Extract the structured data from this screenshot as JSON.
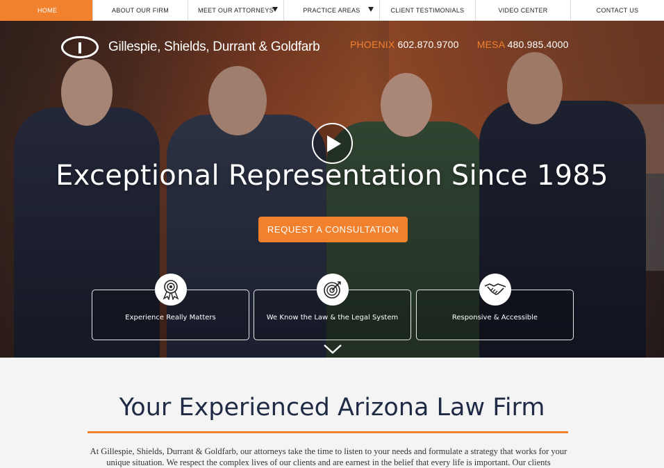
{
  "nav": {
    "items": [
      {
        "label": "HOME",
        "active": true,
        "dropdown": false
      },
      {
        "label": "ABOUT OUR FIRM",
        "active": false,
        "dropdown": false
      },
      {
        "label": "MEET OUR ATTORNEYS",
        "active": false,
        "dropdown": true
      },
      {
        "label": "PRACTICE AREAS",
        "active": false,
        "dropdown": true
      },
      {
        "label": "CLIENT TESTIMONIALS",
        "active": false,
        "dropdown": false
      },
      {
        "label": "VIDEO CENTER",
        "active": false,
        "dropdown": false
      },
      {
        "label": "CONTACT US",
        "active": false,
        "dropdown": false
      }
    ]
  },
  "logo": {
    "text": "Gillespie, Shields, Durrant & Goldfarb"
  },
  "phones": [
    {
      "city": "PHOENIX",
      "number": "602.870.9700"
    },
    {
      "city": "MESA",
      "number": "480.985.4000"
    }
  ],
  "hero": {
    "headline": "Exceptional Representation Since 1985",
    "cta_label": "REQUEST A CONSULTATION",
    "features": [
      {
        "label": "Experience Really Matters",
        "icon": "award-ribbon-icon"
      },
      {
        "label": "We Know the Law & the Legal System",
        "icon": "target-icon"
      },
      {
        "label": "Responsive & Accessible",
        "icon": "handshake-icon"
      }
    ]
  },
  "section": {
    "title": "Your Experienced Arizona Law Firm",
    "body": "At Gillespie, Shields, Durrant & Goldfarb, our attorneys take the time to listen to your needs and formulate a strategy that works for your unique situation. We respect the complex lives of our clients and are earnest in the belief that every life is important. Our clients"
  },
  "colors": {
    "accent": "#f2812e",
    "navy": "#1f2a44"
  }
}
